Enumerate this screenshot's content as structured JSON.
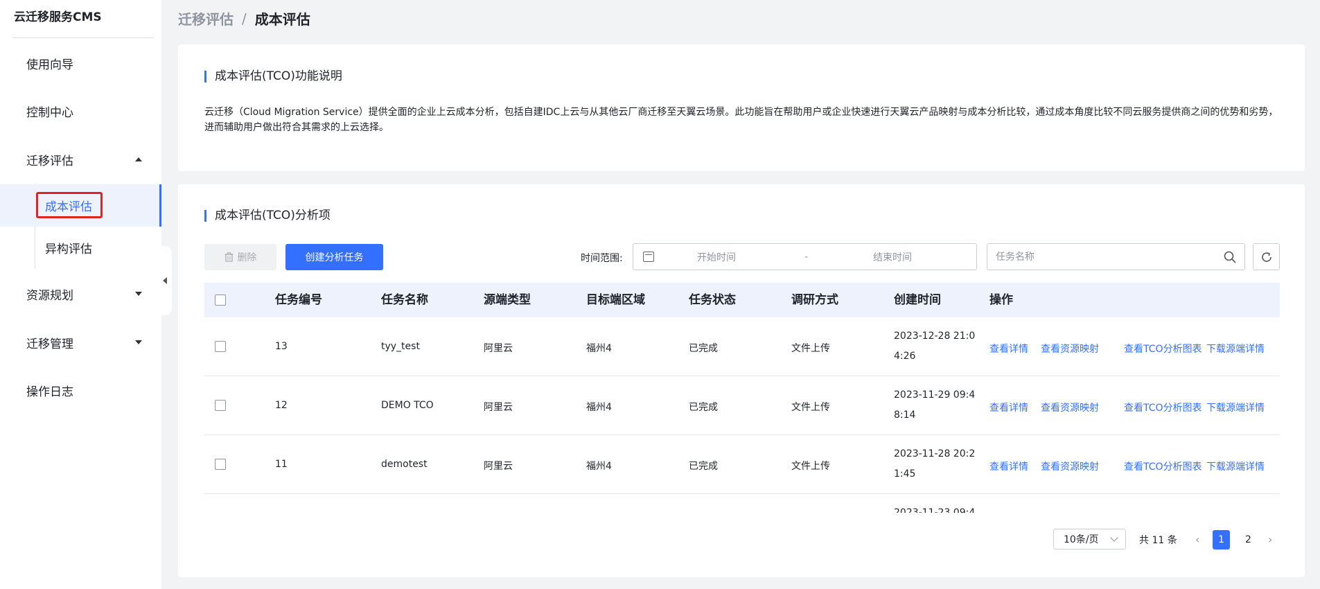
{
  "sidebar": {
    "brand": "云迁移服务CMS",
    "items": [
      {
        "label": "使用向导"
      },
      {
        "label": "控制中心"
      },
      {
        "label": "迁移评估"
      },
      {
        "label": "资源规划"
      },
      {
        "label": "迁移管理"
      },
      {
        "label": "操作日志"
      }
    ],
    "sub_items": [
      {
        "label": "成本评估",
        "active": true
      },
      {
        "label": "异构评估"
      }
    ]
  },
  "breadcrumb": {
    "parent": "迁移评估",
    "separator": "/",
    "current": "成本评估"
  },
  "intro": {
    "title": "成本评估(TCO)功能说明",
    "text": "云迁移（Cloud Migration Service）提供全面的企业上云成本分析，包括自建IDC上云与从其他云厂商迁移至天翼云场景。此功能旨在帮助用户或企业快速进行天翼云产品映射与成本分析比较，通过成本角度比较不同云服务提供商之间的优势和劣势，进而辅助用户做出符合其需求的上云选择。"
  },
  "analysis": {
    "title": "成本评估(TCO)分析项",
    "delete_label": "删除",
    "create_label": "创建分析任务",
    "time_label": "时间范围:",
    "start_placeholder": "开始时间",
    "range_dash": "-",
    "end_placeholder": "结束时间",
    "search_placeholder": "任务名称"
  },
  "table": {
    "columns": [
      "任务编号",
      "任务名称",
      "源端类型",
      "目标端区域",
      "任务状态",
      "调研方式",
      "创建时间",
      "操作"
    ],
    "actions": [
      "查看详情",
      "查看资源映射",
      "查看TCO分析图表",
      "下载源端详情"
    ],
    "rows": [
      {
        "id": "13",
        "name": "tyy_test",
        "source": "阿里云",
        "region": "福州4",
        "status": "已完成",
        "method": "文件上传",
        "created": "2023-12-28 21:04:26"
      },
      {
        "id": "12",
        "name": "DEMO TCO",
        "source": "阿里云",
        "region": "福州4",
        "status": "已完成",
        "method": "文件上传",
        "created": "2023-11-29 09:48:14"
      },
      {
        "id": "11",
        "name": "demotest",
        "source": "阿里云",
        "region": "福州4",
        "status": "已完成",
        "method": "文件上传",
        "created": "2023-11-28 20:21:45"
      },
      {
        "id": "",
        "name": "",
        "source": "",
        "region": "",
        "status": "",
        "method": "",
        "created": "2023-11-23 09:4"
      }
    ]
  },
  "pagination": {
    "page_size": "10条/页",
    "total": "共 11 条",
    "pages": [
      "1",
      "2"
    ],
    "current": "1"
  },
  "colors": {
    "accent": "#3370ff",
    "highlight": "#e02424"
  }
}
